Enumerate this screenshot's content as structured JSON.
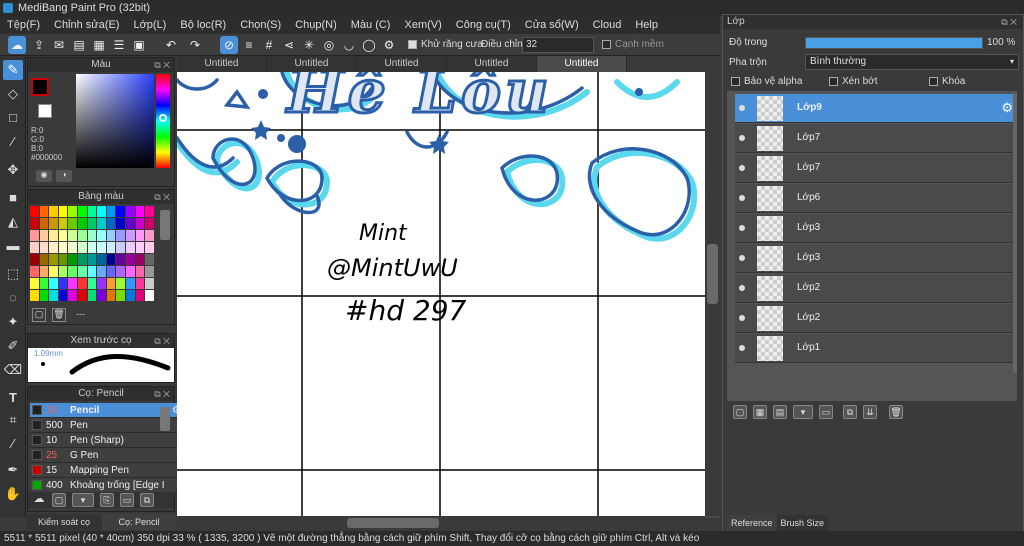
{
  "app": {
    "title": "MediBang Paint Pro (32bit)"
  },
  "menu": [
    "Tệp(F)",
    "Chỉnh sửa(E)",
    "Lớp(L)",
    "Bộ lọc(R)",
    "Chọn(S)",
    "Chụp(N)",
    "Màu (C)",
    "Xem(V)",
    "Công cụ(T)",
    "Cửa sổ(W)",
    "Cloud",
    "Help"
  ],
  "toolbar": {
    "antialias_label": "Khử răng cưa",
    "adjust_label": "Điều chỉnh",
    "adjust_value": "32",
    "edge_label": "Cạnh mềm"
  },
  "tabs": [
    "Untitled",
    "Untitled",
    "Untitled",
    "Untitled",
    "Untitled"
  ],
  "color_panel": {
    "title": "Màu",
    "r": "R:0",
    "g": "G:0",
    "b": "B:0",
    "hex": "#000000"
  },
  "palette_panel": {
    "title": "Bảng màu",
    "dashes": "---"
  },
  "preview_panel": {
    "title": "Xem trước cọ",
    "size": "1.09mm"
  },
  "brush_panel": {
    "title": "Cọ: Pencil",
    "items": [
      {
        "size": "15",
        "name": "Pencil",
        "selected": true
      },
      {
        "size": "500",
        "name": "Pen"
      },
      {
        "size": "10",
        "name": "Pen (Sharp)"
      },
      {
        "size": "25",
        "name": "G Pen"
      },
      {
        "size": "15",
        "name": "Mapping Pen"
      },
      {
        "size": "400",
        "name": "Khoảng trống [Edge I"
      }
    ]
  },
  "left_tabs": [
    "Kiểm soát cọ",
    "Cọ: Pencil"
  ],
  "layer_panel": {
    "title": "Lớp",
    "opacity_label": "Độ trong",
    "opacity_value": "100 %",
    "opacity": 1.0,
    "blend_label": "Pha trộn",
    "blend_value": "Bình thường",
    "protect_alpha": "Bảo vệ alpha",
    "clipping": "Xén bớt",
    "lock": "Khóa",
    "layers": [
      "Lớp9",
      "Lớp7",
      "Lớp7",
      "Lớp6",
      "Lớp3",
      "Lớp3",
      "Lớp2",
      "Lớp2",
      "Lớp1"
    ],
    "bottom_tabs": [
      "Reference",
      "Brush Size"
    ]
  },
  "canvas": {
    "handwriting": [
      "Mint",
      "@MintUwU",
      "#hd 297"
    ]
  },
  "status": "5511 * 5511 pixel  (40 * 40cm)  350 dpi  33 %  ( 1335, 3200 )  Vẽ một đường thẳng bằng cách giữ phím Shift, Thay đổi cỡ cọ bằng cách giữ phím Ctrl, Alt và kéo",
  "colors": {
    "accent": "#4a90d9",
    "ink": "#2b5fa8",
    "glow": "#5ad8ee"
  }
}
